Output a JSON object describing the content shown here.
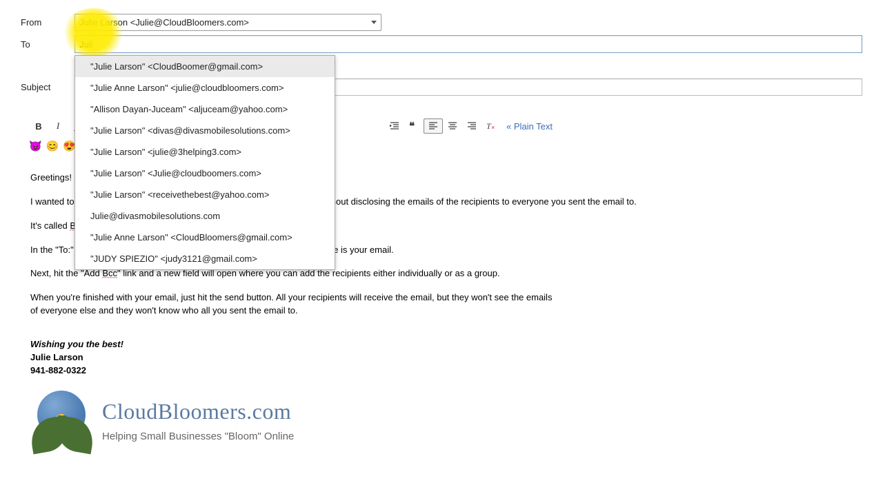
{
  "labels": {
    "from": "From",
    "to": "To",
    "subject": "Subject"
  },
  "from_value": "Julie Larson <Julie@CloudBloomers.com>",
  "to_value": "Juli",
  "autocomplete": [
    "\"Julie Larson\" <CloudBoomer@gmail.com>",
    "\"Julie Anne Larson\" <julie@cloudbloomers.com>",
    "\"Allison Dayan-Juceam\" <aljuceam@yahoo.com>",
    "\"Julie Larson\" <divas@divasmobilesolutions.com>",
    "\"Julie Larson\" <julie@3helping3.com>",
    "\"Julie Larson\" <Julie@cloudboomers.com>",
    "\"Julie Larson\" <receivethebest@yahoo.com>",
    "Julie@divasmobilesolutions.com",
    "\"Julie Anne Larson\" <CloudBloomers@gmail.com>",
    "\"JUDY SPIEZIO\" <judy3121@gmail.com>"
  ],
  "plain_text_link": "« Plain Text",
  "body": {
    "p1": "Greetings!",
    "p2": "I wanted to share a tip on sending an email to multiple people or a group without disclosing the emails of the recipients to everyone you sent the email to.",
    "p3_pre": "It's called ",
    "p3_s": "Bcc",
    "p3_post": ".",
    "p4": "In the \"To:\" field type your own email address so that any of the recipients see is your email.",
    "p5_pre": "Next, hit the \"Add ",
    "p5_s": "Bcc",
    "p5_post": "\" link and a new field will open where you can add the recipients either individually or as a group.",
    "p6": "When you're finished with your email, just hit the send button. All your recipients will receive the email, but they won't see the emails of everyone else and they won't know who all you sent the email to."
  },
  "signature": {
    "line1": "Wishing you the best!",
    "line2": "Julie Larson",
    "line3": "941-882-0322",
    "brand": "CloudBloomers.com",
    "tagline": "Helping Small Businesses \"Bloom\" Online"
  }
}
